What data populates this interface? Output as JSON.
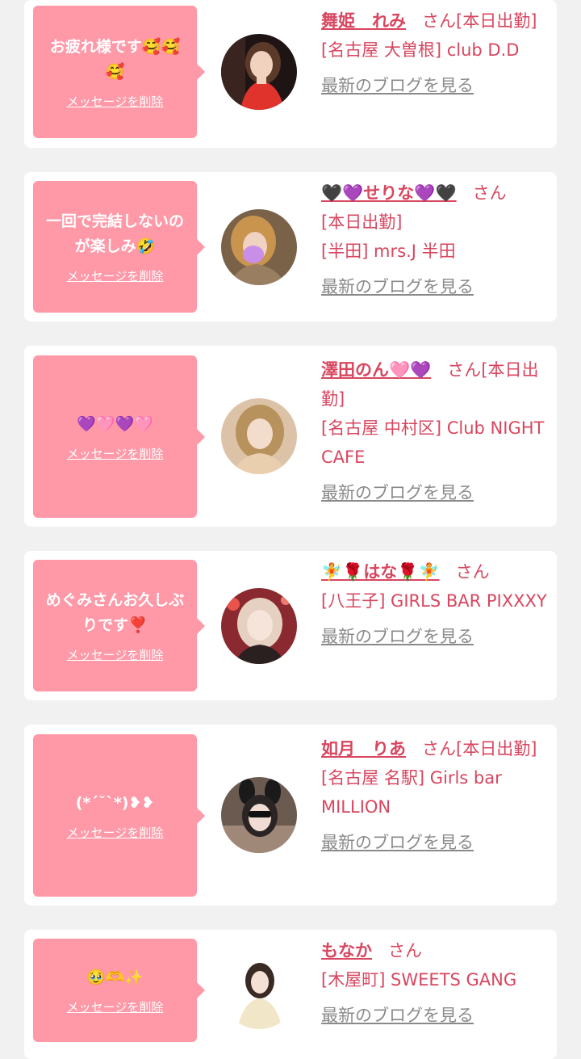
{
  "delete_label": "メッセージを削除",
  "blog_label": "最新のブログを見る",
  "san_label": "さん",
  "colors": {
    "bubble": "#ff98a7",
    "accent": "#d8465f",
    "link_gray": "#8a8a8a",
    "background": "#f1f1f1"
  },
  "items": [
    {
      "message": "お疲れ様です🥰🥰🥰",
      "name": "舞姫　れみ",
      "status": "[本日出勤]",
      "store": "[名古屋 大曽根] club D.D"
    },
    {
      "message": "一回で完結しないのが楽しみ🤣",
      "name": "🖤💜せりな💜🖤",
      "status": "[本日出勤]",
      "store": "[半田] mrs.J 半田"
    },
    {
      "message": "💜🩷💜🩷",
      "name": "澤田のん🩷💜",
      "status": "[本日出勤]",
      "store": "[名古屋 中村区] Club NIGHT CAFE"
    },
    {
      "message": "めぐみさんお久しぶりです❣️",
      "name": "🧚🌹はな🌹🧚",
      "status": "",
      "store": "[八王子] GIRLS BAR PIXXXY"
    },
    {
      "message": "(*´˘`*)❥❥",
      "name": "如月　りあ",
      "status": "[本日出勤]",
      "store": "[名古屋 名駅] Girls bar MILLION"
    },
    {
      "message": "🥹🫶✨",
      "name": "もなか",
      "status": "",
      "store": "[木屋町] SWEETS GANG"
    }
  ]
}
